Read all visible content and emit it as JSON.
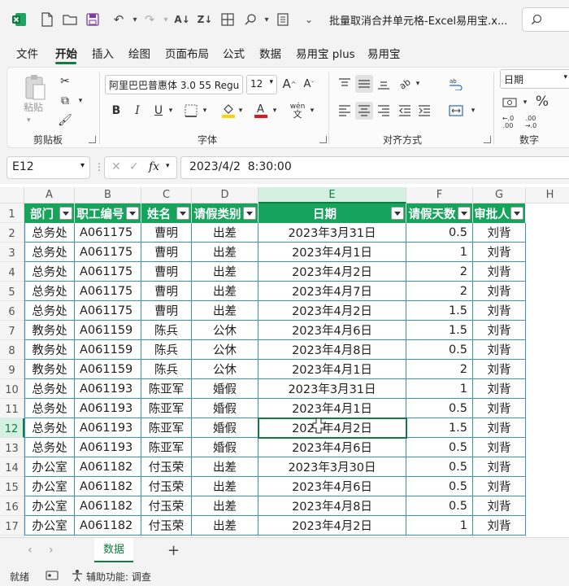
{
  "window": {
    "title": "批量取消合并单元格-Excel易用宝.x...",
    "search_placeholder": ""
  },
  "ribbon_tabs": [
    "文件",
    "开始",
    "插入",
    "绘图",
    "页面布局",
    "公式",
    "数据",
    "易用宝 plus",
    "易用宝"
  ],
  "ribbon": {
    "clipboard": {
      "label": "剪贴板",
      "paste_label": "粘贴"
    },
    "font": {
      "label": "字体",
      "font_name": "阿里巴巴普惠体 3.0 55 Regu",
      "font_size": "12",
      "phonetic_label": "wén"
    },
    "alignment": {
      "label": "对齐方式"
    },
    "number": {
      "label": "数字",
      "format": "日期",
      "percent": "%"
    }
  },
  "formula_bar": {
    "name_box": "E12",
    "formula": "2023/4/2  8:30:00",
    "fx": "fx"
  },
  "columns": [
    "A",
    "B",
    "C",
    "D",
    "E",
    "F",
    "G",
    "H"
  ],
  "header_row": [
    "部门",
    "职工编号",
    "姓名",
    "请假类别",
    "日期",
    "请假天数",
    "审批人"
  ],
  "rows": [
    [
      "总务处",
      "A061175",
      "曹明",
      "出差",
      "2023年3月31日",
      "0.5",
      "刘背"
    ],
    [
      "总务处",
      "A061175",
      "曹明",
      "出差",
      "2023年4月1日",
      "1",
      "刘背"
    ],
    [
      "总务处",
      "A061175",
      "曹明",
      "出差",
      "2023年4月2日",
      "2",
      "刘背"
    ],
    [
      "总务处",
      "A061175",
      "曹明",
      "出差",
      "2023年4月7日",
      "2",
      "刘背"
    ],
    [
      "总务处",
      "A061175",
      "曹明",
      "出差",
      "2023年4月2日",
      "1.5",
      "刘背"
    ],
    [
      "教务处",
      "A061159",
      "陈兵",
      "公休",
      "2023年4月6日",
      "1.5",
      "刘背"
    ],
    [
      "教务处",
      "A061159",
      "陈兵",
      "公休",
      "2023年4月8日",
      "0.5",
      "刘背"
    ],
    [
      "教务处",
      "A061159",
      "陈兵",
      "公休",
      "2023年4月1日",
      "2",
      "刘背"
    ],
    [
      "总务处",
      "A061193",
      "陈亚军",
      "婚假",
      "2023年3月31日",
      "1",
      "刘背"
    ],
    [
      "总务处",
      "A061193",
      "陈亚军",
      "婚假",
      "2023年4月1日",
      "0.5",
      "刘背"
    ],
    [
      "总务处",
      "A061193",
      "陈亚军",
      "婚假",
      "2023年4月2日",
      "1.5",
      "刘背"
    ],
    [
      "总务处",
      "A061193",
      "陈亚军",
      "婚假",
      "2023年4月6日",
      "0.5",
      "刘背"
    ],
    [
      "办公室",
      "A061182",
      "付玉荣",
      "出差",
      "2023年3月30日",
      "0.5",
      "刘背"
    ],
    [
      "办公室",
      "A061182",
      "付玉荣",
      "出差",
      "2023年4月6日",
      "0.5",
      "刘背"
    ],
    [
      "办公室",
      "A061182",
      "付玉荣",
      "出差",
      "2023年4月8日",
      "0.5",
      "刘背"
    ],
    [
      "办公室",
      "A061182",
      "付玉荣",
      "出差",
      "2023年4月2日",
      "1",
      "刘背"
    ]
  ],
  "active_cell": "E12",
  "sheet_tabs": [
    "数据"
  ],
  "status": {
    "ready": "就绪",
    "accessibility": "辅助功能: 调查"
  },
  "colors": {
    "accent": "#107c41",
    "header_fill": "#16a35c",
    "cell_border": "#3b8ed4"
  }
}
